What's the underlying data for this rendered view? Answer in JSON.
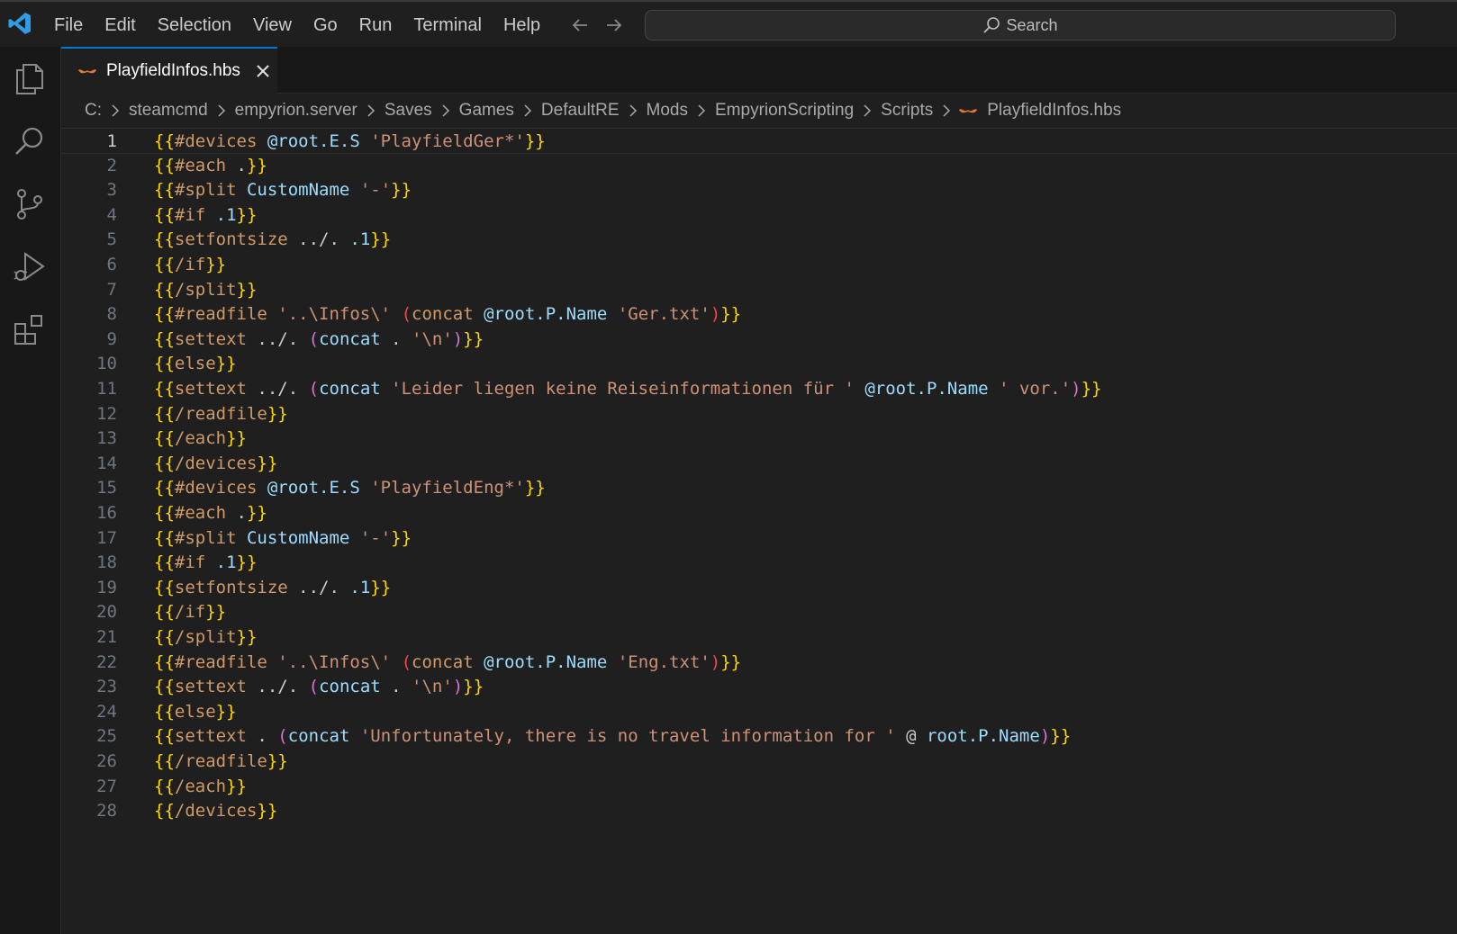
{
  "menu": [
    "File",
    "Edit",
    "Selection",
    "View",
    "Go",
    "Run",
    "Terminal",
    "Help"
  ],
  "search": {
    "label": "Search"
  },
  "tab": {
    "label": "PlayfieldInfos.hbs"
  },
  "breadcrumb": [
    "C:",
    "steamcmd",
    "empyrion.server",
    "Saves",
    "Games",
    "DefaultRE",
    "Mods",
    "EmpyrionScripting",
    "Scripts",
    "PlayfieldInfos.hbs"
  ],
  "editor": {
    "current_line": 1,
    "lines": [
      [
        [
          "b",
          "{{"
        ],
        [
          "k",
          "#devices "
        ],
        [
          "v",
          "@root.E.S "
        ],
        [
          "s",
          "'PlayfieldGer*'"
        ],
        [
          "b",
          "}}"
        ]
      ],
      [
        [
          "b",
          "{{"
        ],
        [
          "k",
          "#each "
        ],
        [
          "d",
          "."
        ],
        [
          "b",
          "}}"
        ]
      ],
      [
        [
          "b",
          "{{"
        ],
        [
          "k",
          "#split "
        ],
        [
          "v",
          "CustomName "
        ],
        [
          "s",
          "'-'"
        ],
        [
          "b",
          "}}"
        ]
      ],
      [
        [
          "b",
          "{{"
        ],
        [
          "k",
          "#if "
        ],
        [
          "v",
          ".1"
        ],
        [
          "b",
          "}}"
        ]
      ],
      [
        [
          "b",
          "{{"
        ],
        [
          "k",
          "setfontsize "
        ],
        [
          "d",
          "../. "
        ],
        [
          "v",
          ".1"
        ],
        [
          "b",
          "}}"
        ]
      ],
      [
        [
          "b",
          "{{"
        ],
        [
          "k",
          "/if"
        ],
        [
          "b",
          "}}"
        ]
      ],
      [
        [
          "b",
          "{{"
        ],
        [
          "k",
          "/split"
        ],
        [
          "b",
          "}}"
        ]
      ],
      [
        [
          "b",
          "{{"
        ],
        [
          "k",
          "#readfile "
        ],
        [
          "s",
          "'..\\Infos\\' "
        ],
        [
          "r",
          "("
        ],
        [
          "k",
          "concat "
        ],
        [
          "v",
          "@root.P.Name "
        ],
        [
          "s",
          "'Ger.txt'"
        ],
        [
          "r",
          ")"
        ],
        [
          "b",
          "}}"
        ]
      ],
      [
        [
          "b",
          "{{"
        ],
        [
          "k",
          "settext "
        ],
        [
          "d",
          "../. "
        ],
        [
          "p",
          "("
        ],
        [
          "v",
          "concat "
        ],
        [
          "d",
          ". "
        ],
        [
          "s",
          "'\\n'"
        ],
        [
          "p",
          ")"
        ],
        [
          "b",
          "}}"
        ]
      ],
      [
        [
          "b",
          "{{"
        ],
        [
          "k",
          "else"
        ],
        [
          "b",
          "}}"
        ]
      ],
      [
        [
          "b",
          "{{"
        ],
        [
          "k",
          "settext "
        ],
        [
          "d",
          "../. "
        ],
        [
          "p",
          "("
        ],
        [
          "v",
          "concat "
        ],
        [
          "s",
          "'Leider liegen keine Reiseinformationen für ' "
        ],
        [
          "v",
          "@root.P.Name "
        ],
        [
          "s",
          "' vor.'"
        ],
        [
          "p",
          ")"
        ],
        [
          "b",
          "}}"
        ]
      ],
      [
        [
          "b",
          "{{"
        ],
        [
          "k",
          "/readfile"
        ],
        [
          "b",
          "}}"
        ]
      ],
      [
        [
          "b",
          "{{"
        ],
        [
          "k",
          "/each"
        ],
        [
          "b",
          "}}"
        ]
      ],
      [
        [
          "b",
          "{{"
        ],
        [
          "k",
          "/devices"
        ],
        [
          "b",
          "}}"
        ]
      ],
      [
        [
          "b",
          "{{"
        ],
        [
          "k",
          "#devices "
        ],
        [
          "v",
          "@root.E.S "
        ],
        [
          "s",
          "'PlayfieldEng*'"
        ],
        [
          "b",
          "}}"
        ]
      ],
      [
        [
          "b",
          "{{"
        ],
        [
          "k",
          "#each "
        ],
        [
          "d",
          "."
        ],
        [
          "b",
          "}}"
        ]
      ],
      [
        [
          "b",
          "{{"
        ],
        [
          "k",
          "#split "
        ],
        [
          "v",
          "CustomName "
        ],
        [
          "s",
          "'-'"
        ],
        [
          "b",
          "}}"
        ]
      ],
      [
        [
          "b",
          "{{"
        ],
        [
          "k",
          "#if "
        ],
        [
          "v",
          ".1"
        ],
        [
          "b",
          "}}"
        ]
      ],
      [
        [
          "b",
          "{{"
        ],
        [
          "k",
          "setfontsize "
        ],
        [
          "d",
          "../. "
        ],
        [
          "v",
          ".1"
        ],
        [
          "b",
          "}}"
        ]
      ],
      [
        [
          "b",
          "{{"
        ],
        [
          "k",
          "/if"
        ],
        [
          "b",
          "}}"
        ]
      ],
      [
        [
          "b",
          "{{"
        ],
        [
          "k",
          "/split"
        ],
        [
          "b",
          "}}"
        ]
      ],
      [
        [
          "b",
          "{{"
        ],
        [
          "k",
          "#readfile "
        ],
        [
          "s",
          "'..\\Infos\\' "
        ],
        [
          "r",
          "("
        ],
        [
          "k",
          "concat "
        ],
        [
          "v",
          "@root.P.Name "
        ],
        [
          "s",
          "'Eng.txt'"
        ],
        [
          "r",
          ")"
        ],
        [
          "b",
          "}}"
        ]
      ],
      [
        [
          "b",
          "{{"
        ],
        [
          "k",
          "settext "
        ],
        [
          "d",
          "../. "
        ],
        [
          "p",
          "("
        ],
        [
          "v",
          "concat "
        ],
        [
          "d",
          ". "
        ],
        [
          "s",
          "'\\n'"
        ],
        [
          "p",
          ")"
        ],
        [
          "b",
          "}}"
        ]
      ],
      [
        [
          "b",
          "{{"
        ],
        [
          "k",
          "else"
        ],
        [
          "b",
          "}}"
        ]
      ],
      [
        [
          "b",
          "{{"
        ],
        [
          "k",
          "settext "
        ],
        [
          "d",
          ". "
        ],
        [
          "p",
          "("
        ],
        [
          "v",
          "concat "
        ],
        [
          "s",
          "'Unfortunately, there is no travel information for ' "
        ],
        [
          "d",
          "@ "
        ],
        [
          "v",
          "root.P.Name"
        ],
        [
          "p",
          ")"
        ],
        [
          "b",
          "}}"
        ]
      ],
      [
        [
          "b",
          "{{"
        ],
        [
          "k",
          "/readfile"
        ],
        [
          "b",
          "}}"
        ]
      ],
      [
        [
          "b",
          "{{"
        ],
        [
          "k",
          "/each"
        ],
        [
          "b",
          "}}"
        ]
      ],
      [
        [
          "b",
          "{{"
        ],
        [
          "k",
          "/devices"
        ],
        [
          "b",
          "}}"
        ]
      ]
    ]
  },
  "colors": {
    "accent": "#0078d4",
    "hbs_icon": "#e37933"
  }
}
